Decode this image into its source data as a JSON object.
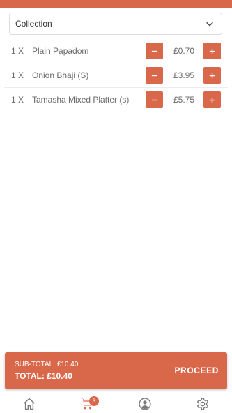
{
  "colors": {
    "accent": "#d9674a",
    "icon_inactive": "#7a7a7a",
    "badge_bg": "#d9674a",
    "text": "#6a6a6a"
  },
  "order_type": {
    "selected": "Collection",
    "icon": "chevron-down-icon"
  },
  "cart": {
    "items": [
      {
        "qty": "1 X",
        "name": "Plain Papadom",
        "price": "£0.70"
      },
      {
        "qty": "1 X",
        "name": "Onion Bhaji (S)",
        "price": "£3.95"
      },
      {
        "qty": "1 X",
        "name": "Tamasha Mixed Platter (s)",
        "price": "£5.75"
      }
    ]
  },
  "summary": {
    "subtotal": "SUB-TOTAL: £10.40",
    "total": "TOTAL: £10.40",
    "proceed_label": "PROCEED"
  },
  "bottom_nav": {
    "items": [
      {
        "icon": "home-icon",
        "active": false
      },
      {
        "icon": "cart-icon",
        "active": true,
        "badge": "3"
      },
      {
        "icon": "account-icon",
        "active": false
      },
      {
        "icon": "settings-icon",
        "active": false
      }
    ]
  }
}
